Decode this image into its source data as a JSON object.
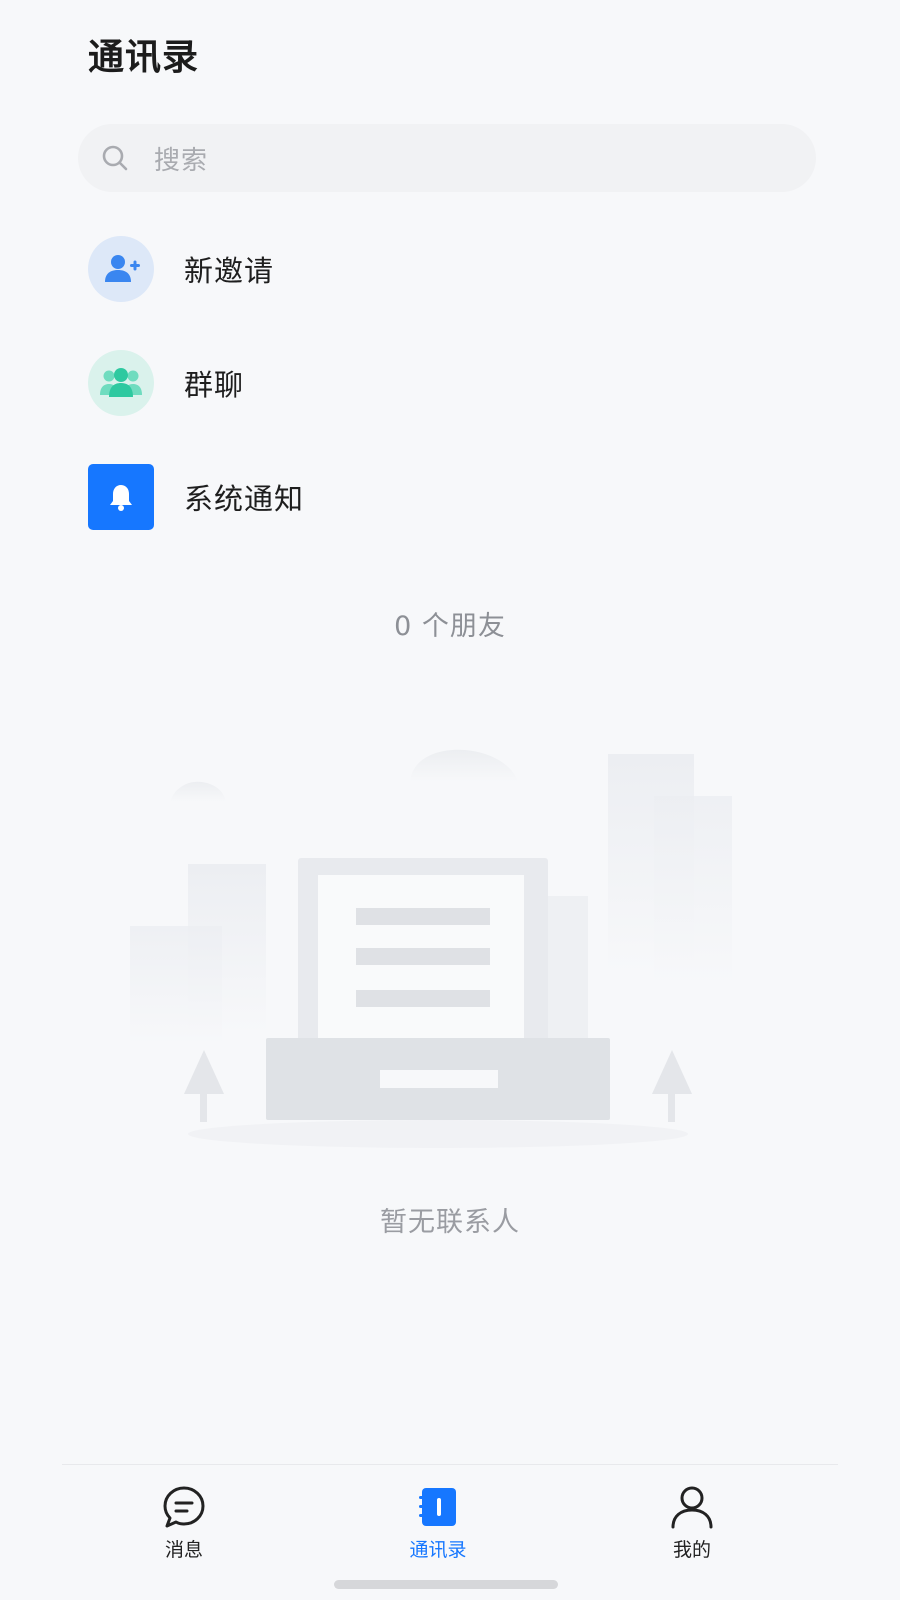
{
  "header": {
    "title": "通讯录"
  },
  "search": {
    "placeholder": "搜索"
  },
  "entries": [
    {
      "label": "新邀请",
      "icon": "add-user-icon"
    },
    {
      "label": "群聊",
      "icon": "group-icon"
    },
    {
      "label": "系统通知",
      "icon": "bell-icon"
    }
  ],
  "friend_count": "0 个朋友",
  "empty_state": {
    "text": "暂无联系人",
    "icon": "empty-contacts-illustration"
  },
  "tabbar": {
    "tabs": [
      {
        "label": "消息",
        "icon": "message-icon",
        "active": false
      },
      {
        "label": "通讯录",
        "icon": "contacts-book-icon",
        "active": true
      },
      {
        "label": "我的",
        "icon": "person-icon",
        "active": false
      }
    ]
  },
  "colors": {
    "accent": "#1677ff",
    "invite_bg": "#dde8f8",
    "group_bg": "#daf2ec",
    "group_icon": "#2ec9a0",
    "background": "#f7f8fa"
  }
}
